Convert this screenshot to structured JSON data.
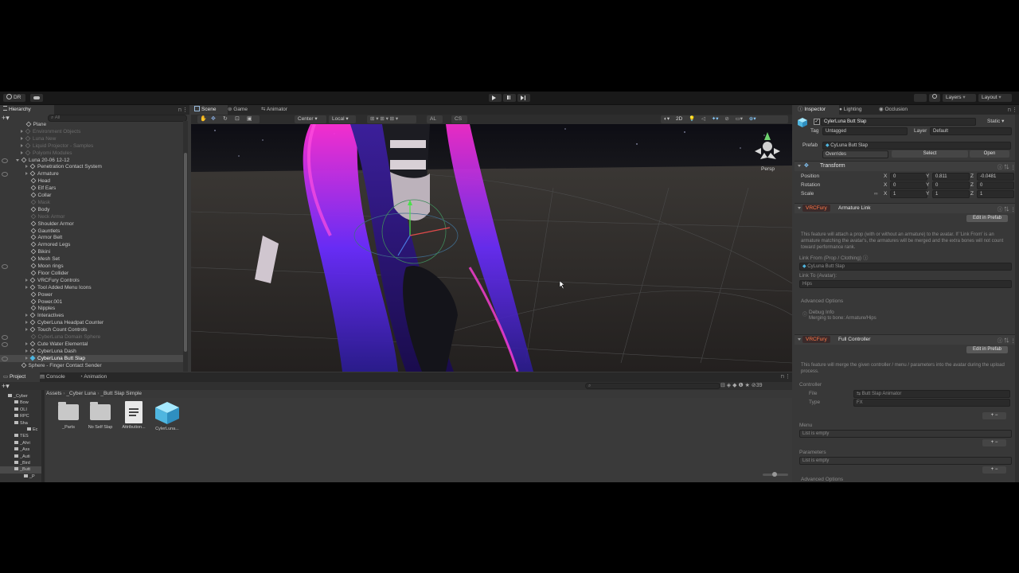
{
  "toolbar": {
    "account": "DR",
    "layers": "Layers",
    "layout": "Layout"
  },
  "hierarchy": {
    "title": "Hierarchy",
    "search_placeholder": "All",
    "items": [
      {
        "label": "Plane",
        "dim": false
      },
      {
        "label": "Environment Objects",
        "dim": true
      },
      {
        "label": "Luna New",
        "dim": true
      },
      {
        "label": "Liquid Projector - Samples",
        "dim": true
      },
      {
        "label": "Polyomi Modules",
        "dim": true
      },
      {
        "label": "Luna 20-06 12-12",
        "dim": false
      },
      {
        "label": "Penetration Contact System",
        "dim": false
      },
      {
        "label": "Armature",
        "dim": false
      },
      {
        "label": "Head",
        "dim": false
      },
      {
        "label": "Elf Ears",
        "dim": false
      },
      {
        "label": "Collar",
        "dim": false
      },
      {
        "label": "Mask",
        "dim": true
      },
      {
        "label": "Body",
        "dim": false
      },
      {
        "label": "Neck Armor",
        "dim": true
      },
      {
        "label": "Shoulder Armor",
        "dim": false
      },
      {
        "label": "Gauntlets",
        "dim": false
      },
      {
        "label": "Armor Belt",
        "dim": false
      },
      {
        "label": "Armored Legs",
        "dim": false
      },
      {
        "label": "Bikini",
        "dim": false
      },
      {
        "label": "Mesh Set",
        "dim": false
      },
      {
        "label": "Moon rings",
        "dim": false
      },
      {
        "label": "Floor Collider",
        "dim": false
      },
      {
        "label": "VRCFury Controls",
        "dim": false
      },
      {
        "label": "Tool Added Menu Icons",
        "dim": false
      },
      {
        "label": "Power",
        "dim": false
      },
      {
        "label": "Power.001",
        "dim": false
      },
      {
        "label": "Nipples",
        "dim": false
      },
      {
        "label": "Interactives",
        "dim": false
      },
      {
        "label": "CyberLuna Headpat Counter",
        "dim": false
      },
      {
        "label": "Touch Count Controls",
        "dim": false
      },
      {
        "label": "CyberLuna Domain Sphere",
        "dim": true
      },
      {
        "label": "Cute Water Elemental",
        "dim": false
      },
      {
        "label": "CyberLuna Dash",
        "dim": false
      },
      {
        "label": "CyberLuna Butt Slap",
        "dim": false
      },
      {
        "label": "Sphere - Finger Contact Sender",
        "dim": false
      }
    ]
  },
  "scene": {
    "tabs": [
      "Scene",
      "Game",
      "Animator"
    ],
    "pivot": "Center",
    "space": "Local",
    "mode_2d": "2D",
    "persp": "Persp"
  },
  "project": {
    "tabs": [
      "Project",
      "Console",
      "Animation"
    ],
    "breadcrumb": [
      "Assets",
      "_Cyber Luna",
      "_Butt Slap Simple"
    ],
    "tree": [
      "_Cyber",
      "Bow",
      "OLI",
      "RPC",
      "Sha",
      "Ec",
      "TES",
      "_Ahri",
      "_Ass",
      "_Auti",
      "_Bird",
      "_Butt",
      "_P"
    ],
    "assets": [
      "_Parts",
      "No Self Slap",
      "Attribution...",
      "CylerLuna..."
    ],
    "count": "39"
  },
  "inspector": {
    "tabs": [
      "Inspector",
      "Lighting",
      "Occlusion"
    ],
    "object_name": "CylerLuna Butt Slap",
    "static_label": "Static",
    "tag_label": "Tag",
    "tag_value": "Untagged",
    "layer_label": "Layer",
    "layer_value": "Default",
    "prefab_label": "Prefab",
    "prefab_value": "CyLuna Butt Slap",
    "overrides": "Overrides",
    "select": "Select",
    "open": "Open",
    "transform": {
      "title": "Transform",
      "rows": [
        {
          "label": "Position",
          "x": "0",
          "y": "0.811",
          "z": "-0.0481"
        },
        {
          "label": "Rotation",
          "x": "0",
          "y": "0",
          "z": "0"
        },
        {
          "label": "Scale",
          "x": "1",
          "y": "1",
          "z": "1"
        }
      ]
    },
    "armature_link": {
      "badge": "VRCFury",
      "title": "Armature Link",
      "edit_btn": "Edit in Prefab",
      "description": "This feature will attach a prop (with or without an armature) to the avatar. If 'Link From' is an armature matching the avatar's, the armatures will be merged and the extra bones will not count toward performance rank.",
      "link_from_label": "Link From (Prop / Clothing)",
      "link_from_value": "CyLuna Butt Slap",
      "link_to_label": "Link To (Avatar):",
      "link_to_value": "Hips",
      "advanced": "Advanced Options",
      "debug_title": "Debug Info",
      "debug_text": "Merging to bone: Armature/Hips"
    },
    "full_controller": {
      "badge": "VRCFury",
      "title": "Full Controller",
      "edit_btn": "Edit in Prefab",
      "description": "This feature will merge the given controller / menu / parameters into the avatar during the upload process.",
      "controller_label": "Controller",
      "file_label": "File",
      "file_value": "Butt Slap Animator",
      "type_label": "Type",
      "type_value": "FX",
      "menu_label": "Menu",
      "menu_empty": "List is empty",
      "params_label": "Parameters",
      "params_empty": "List is empty",
      "advanced": "Advanced Options"
    }
  },
  "colors": {
    "accent": "#2c5d87",
    "vrcfury": "#ff7a4a",
    "neon_pink": "#ff2fd6",
    "neon_blue": "#3b3bff"
  }
}
